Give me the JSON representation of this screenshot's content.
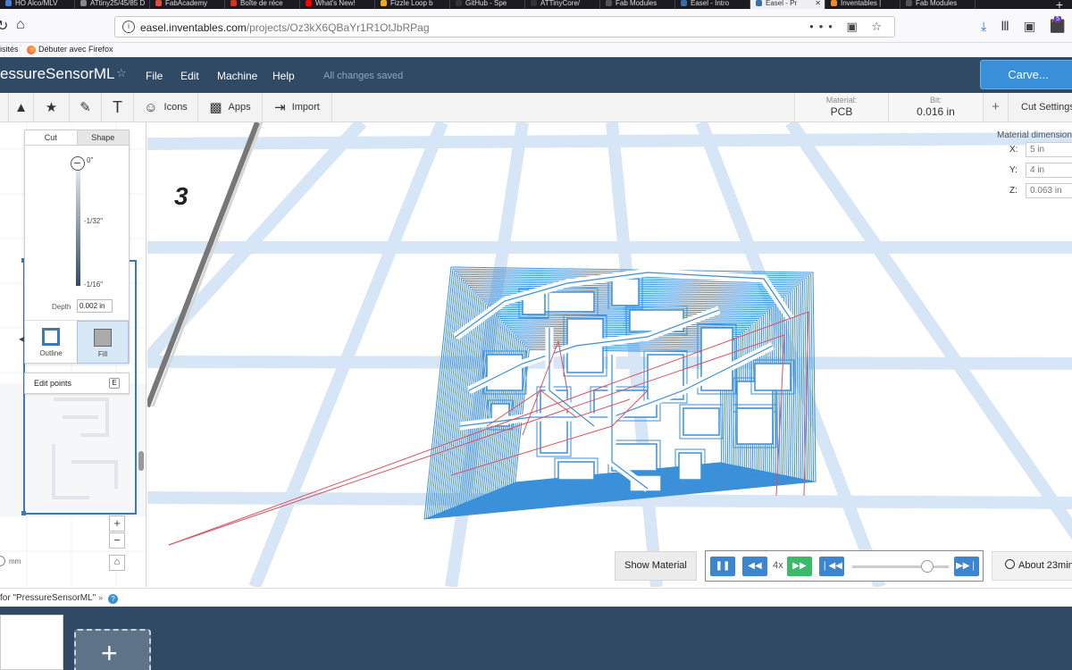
{
  "browser": {
    "tabs": [
      {
        "label": "HO Alco/MLV",
        "color": "#4a7fd6"
      },
      {
        "label": "ATtiny25/45/85 D",
        "color": "#888888"
      },
      {
        "label": "FabAcademy",
        "color": "#e04e39"
      },
      {
        "label": "Boîte de réce",
        "color": "#d93025"
      },
      {
        "label": "What's New!",
        "color": "#ff0000"
      },
      {
        "label": "Fizzle Loop b",
        "color": "#f5a623"
      },
      {
        "label": "GitHub - Spe",
        "color": "#333333"
      },
      {
        "label": "ATTinyCore/",
        "color": "#333333"
      },
      {
        "label": "Fab Modules",
        "color": "#555555"
      },
      {
        "label": "Easel - Intro",
        "color": "#3a6ea5"
      },
      {
        "label": "Easel - Pr",
        "color": "#3a6ea5",
        "active": true
      },
      {
        "label": "Inventables |",
        "color": "#f28c28"
      },
      {
        "label": "Fab Modules",
        "color": "#555555"
      }
    ],
    "new_tab": "+",
    "url_host": "easel.inventables.com",
    "url_path": "/projects/Oz3kX6QBaYr1R1OtJbRPag",
    "url_actions": "••• ▣ ☆",
    "downloads_badge": "5",
    "bookmarks": {
      "visited": "isités",
      "getting_started": "Débuter avec Firefox"
    }
  },
  "app": {
    "project_title": "essureSensorML",
    "star": "☆",
    "menus": [
      "File",
      "Edit",
      "Machine",
      "Help"
    ],
    "save_status": "All changes saved",
    "carve_label": "Carve..."
  },
  "toolbar": {
    "tools": [
      {
        "glyph": "▲",
        "label": ""
      },
      {
        "glyph": "★",
        "label": ""
      },
      {
        "glyph": "✎",
        "label": ""
      },
      {
        "glyph": "T",
        "label": ""
      },
      {
        "glyph": "☺",
        "label": "Icons"
      },
      {
        "glyph": "▩",
        "label": "Apps"
      },
      {
        "glyph": "⇥",
        "label": "Import"
      }
    ],
    "material_label": "Material:",
    "material_value": "PCB",
    "bit_label": "Bit:",
    "bit_value": "0.016 in",
    "add": "+",
    "cut_settings": "Cut Settings"
  },
  "inspector": {
    "tabs": [
      "Cut",
      "Shape"
    ],
    "depth_marks": [
      "0\"",
      "-1/32\"",
      "-1/16\""
    ],
    "depth_label": "Depth",
    "depth_value": "0.002 in",
    "modes": [
      "Outline",
      "Fill"
    ],
    "selected_mode": "Fill",
    "edit_points": "Edit points",
    "edit_points_key": "E",
    "zoom_in": "+",
    "zoom_out": "−",
    "home": "⌂",
    "unit": "mm",
    "panel_handle": "⋮"
  },
  "preview": {
    "axis_marker": "3"
  },
  "material_dims": {
    "title": "Material dimensions",
    "x_label": "X:",
    "x_value": "5 in",
    "y_label": "Y:",
    "y_value": "4 in",
    "z_label": "Z:",
    "z_value": "0.063 in"
  },
  "playback": {
    "show_material": "Show Material",
    "pause": "❚❚",
    "rewind": "◀◀",
    "speed": "4x",
    "fast_forward": "▶▶",
    "to_start": "❘◀◀",
    "to_end": "▶▶❘",
    "progress": 0.78,
    "estimate": "About 23min"
  },
  "workspace": {
    "label": "for \"PressureSensorML\"",
    "chevron": "»",
    "help": "?",
    "add_design": "+"
  },
  "colors": {
    "header": "#304a66",
    "accent": "#3a8fd9",
    "toolpath": "#3a8fd9",
    "travel": "#d9535f",
    "grid": "#d6e6f7"
  }
}
